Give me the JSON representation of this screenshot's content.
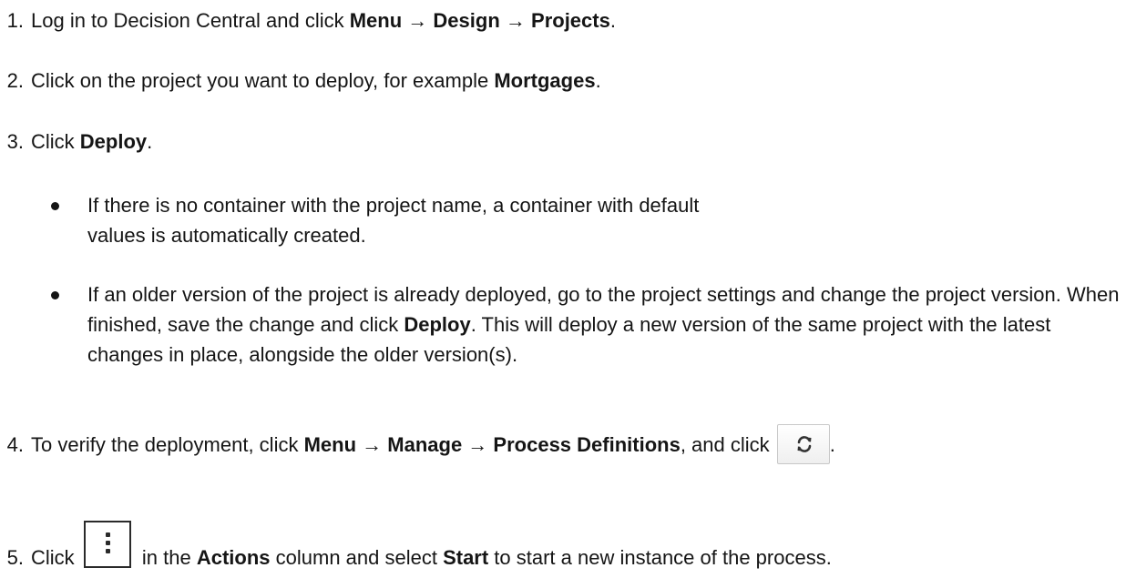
{
  "steps": [
    {
      "num": "1.",
      "parts": {
        "a": "Log in to Decision Central and click ",
        "b1": "Menu",
        "c": " → ",
        "b2": "Design",
        "d": " → ",
        "b3": "Projects",
        "e": "."
      }
    },
    {
      "num": "2.",
      "parts": {
        "a": "Click on the project you want to deploy, for example ",
        "b1": "Mortgages",
        "c": "."
      }
    },
    {
      "num": "3.",
      "parts": {
        "a": "Click ",
        "b1": "Deploy",
        "c": "."
      },
      "bullets": [
        {
          "a": "If there is no container with the project name, a container with default values is automatically created."
        },
        {
          "a": "If an older version of the project is already deployed, go to the project settings and change the project version. When finished, save the change and click ",
          "b1": "Deploy",
          "c": ". This will deploy a new version of the same project with the latest changes in place, alongside the older version(s)."
        }
      ]
    },
    {
      "num": "4.",
      "parts": {
        "a": "To verify the deployment, click ",
        "b1": "Menu",
        "c": " → ",
        "b2": "Manage",
        "d": " → ",
        "b3": "Process Definitions",
        "e": ", and click ",
        "f": "."
      },
      "icon": "refresh-icon"
    },
    {
      "num": "5.",
      "parts": {
        "a": "Click ",
        "b": " in the ",
        "b1": "Actions",
        "c": " column and select ",
        "b2": "Start",
        "d": " to start a new instance of the process."
      },
      "icon": "kebab-icon"
    }
  ]
}
